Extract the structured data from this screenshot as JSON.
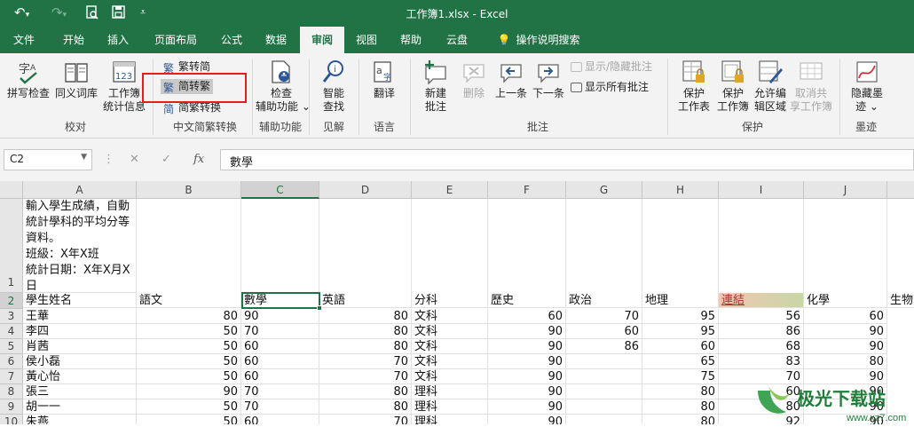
{
  "app": {
    "title": "工作簿1.xlsx  -  Excel",
    "accent": "#217346"
  },
  "quick_access": {
    "undo_icon": "undo-icon",
    "redo_icon": "redo-icon",
    "print_preview_icon": "print-preview-icon",
    "save_icon": "save-icon",
    "customize_icon": "customize-icon"
  },
  "tabs": [
    {
      "label": "文件"
    },
    {
      "label": "开始"
    },
    {
      "label": "插入"
    },
    {
      "label": "页面布局"
    },
    {
      "label": "公式"
    },
    {
      "label": "数据"
    },
    {
      "label": "审阅"
    },
    {
      "label": "视图"
    },
    {
      "label": "帮助"
    },
    {
      "label": "云盘"
    },
    {
      "label": "操作说明搜索"
    }
  ],
  "ribbon": {
    "proofing": {
      "spellcheck": "拼写检查",
      "thesaurus": "同义词库",
      "stats_line1": "工作簿",
      "stats_line2": "统计信息",
      "group": "校对"
    },
    "chinese": {
      "to_simplified": "繁转简",
      "to_traditional": "简转繁",
      "convert": "简繁转换",
      "group": "中文简繁转换"
    },
    "accessibility": {
      "line1": "检查",
      "line2": "辅助功能 ⌄",
      "group": "辅助功能"
    },
    "insights": {
      "line1": "智能",
      "line2": "查找",
      "group": "见解"
    },
    "language": {
      "translate": "翻译",
      "group": "语言"
    },
    "comments": {
      "new_line1": "新建",
      "new_line2": "批注",
      "delete": "删除",
      "previous": "上一条",
      "next": "下一条",
      "show_hide": "显示/隐藏批注",
      "show_all": "显示所有批注",
      "group": "批注"
    },
    "protect": {
      "sheet_line1": "保护",
      "sheet_line2": "工作表",
      "workbook_line1": "保护",
      "workbook_line2": "工作簿",
      "ranges_line1": "允许编",
      "ranges_line2": "辑区域",
      "unshare_line1": "取消共",
      "unshare_line2": "享工作簿",
      "group": "保护"
    },
    "ink": {
      "line1": "隐藏墨",
      "line2": "迹 ⌄",
      "group": "墨迹"
    }
  },
  "formula_bar": {
    "name_box": "C2",
    "cancel": "✕",
    "enter": "✓",
    "fx": "fx",
    "content": "數學"
  },
  "sheet": {
    "columns": [
      "A",
      "B",
      "C",
      "D",
      "E",
      "F",
      "G",
      "H",
      "I",
      "J",
      ""
    ],
    "rows": [
      "1",
      "2",
      "3",
      "4",
      "5",
      "6",
      "7",
      "8",
      "9",
      "10"
    ],
    "a1_text": "輸入學生成績，自動統計學科的平均分等資料。\n班級：X年X班\n統計日期：X年X月X日",
    "headers": [
      "學生姓名",
      "語文",
      "數學",
      "英語",
      "分科",
      "歷史",
      "政治",
      "地理",
      "連結",
      "化學",
      "生物"
    ],
    "data": [
      [
        "王華",
        "80",
        "90",
        "80",
        "文科",
        "60",
        "70",
        "95",
        "56",
        "60"
      ],
      [
        "李四",
        "50",
        "70",
        "80",
        "文科",
        "90",
        "60",
        "95",
        "86",
        "90"
      ],
      [
        "肖茜",
        "50",
        "60",
        "80",
        "文科",
        "90",
        "86",
        "60",
        "68",
        "90"
      ],
      [
        "侯小磊",
        "50",
        "60",
        "70",
        "文科",
        "90",
        "",
        "65",
        "83",
        "80"
      ],
      [
        "黃心怡",
        "50",
        "60",
        "70",
        "文科",
        "90",
        "",
        "75",
        "70",
        "90"
      ],
      [
        "張三",
        "90",
        "70",
        "80",
        "理科",
        "90",
        "",
        "80",
        "60",
        "90"
      ],
      [
        "胡一一",
        "50",
        "70",
        "80",
        "理科",
        "90",
        "",
        "80",
        "80",
        "90"
      ],
      [
        "朱燕",
        "50",
        "60",
        "70",
        "理科",
        "90",
        "",
        "80",
        "92",
        "90"
      ]
    ]
  },
  "watermark": {
    "name": "极光下载站",
    "url": "www.xz7.com"
  }
}
